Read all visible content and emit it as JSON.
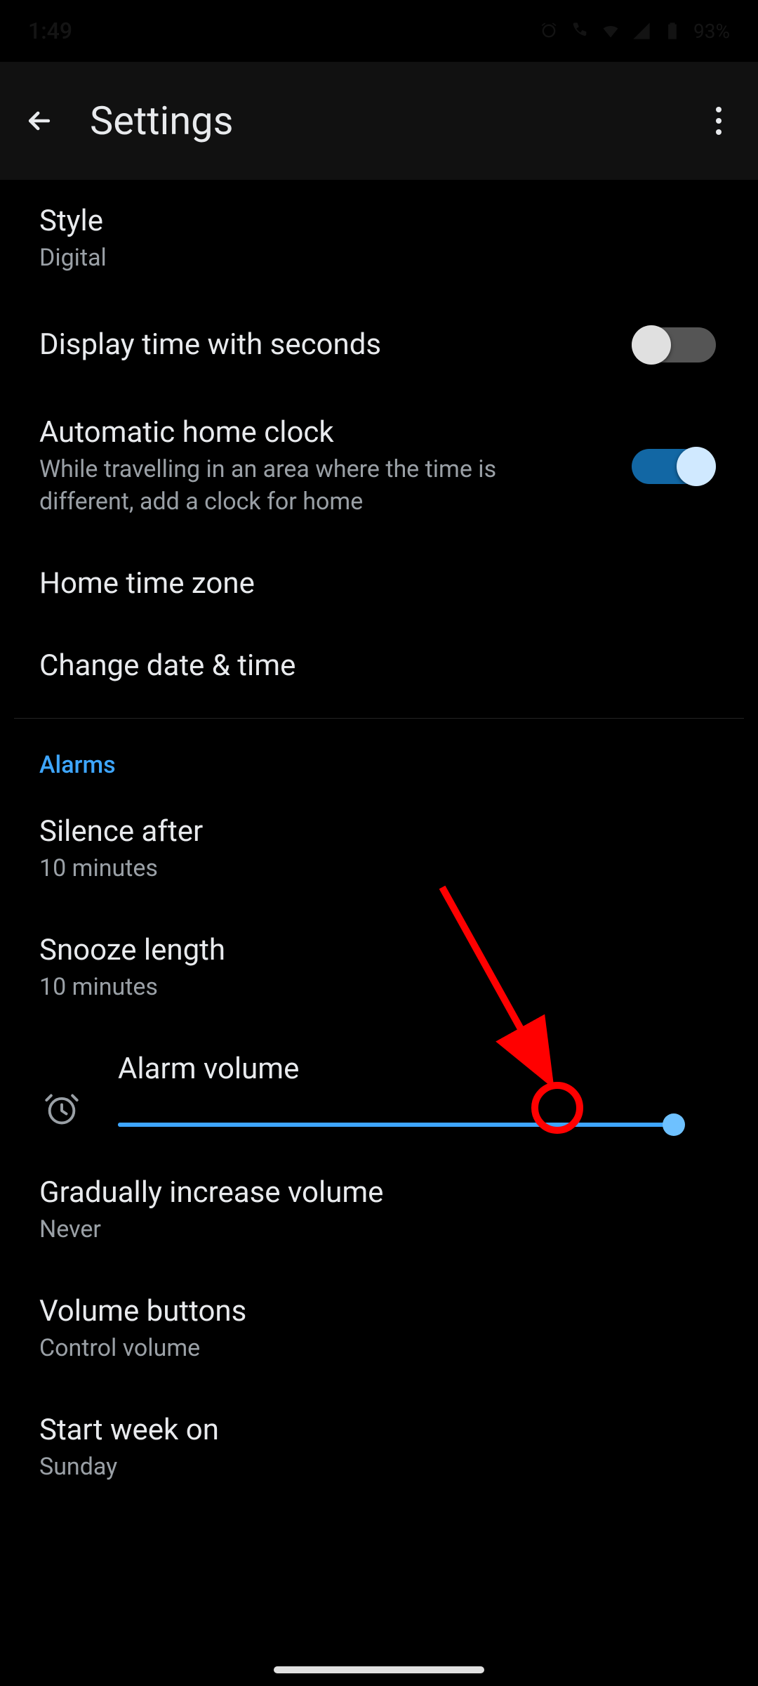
{
  "statusbar": {
    "time": "1:49",
    "battery_text": "93%"
  },
  "toolbar": {
    "title": "Settings"
  },
  "sections": {
    "style": {
      "title": "Style",
      "value": "Digital"
    },
    "displaySeconds": {
      "title": "Display time with seconds",
      "on": false
    },
    "autoHomeClock": {
      "title": "Automatic home clock",
      "subtitle": "While travelling in an area where the time is different, add a clock for home",
      "on": true
    },
    "homeTimeZone": {
      "title": "Home time zone"
    },
    "changeDateTime": {
      "title": "Change date & time"
    },
    "alarmsHeader": "Alarms",
    "silenceAfter": {
      "title": "Silence after",
      "value": "10 minutes"
    },
    "snoozeLength": {
      "title": "Snooze length",
      "value": "10 minutes"
    },
    "alarmVolume": {
      "title": "Alarm volume",
      "value_percent": 100
    },
    "graduallyIncrease": {
      "title": "Gradually increase volume",
      "value": "Never"
    },
    "volumeButtons": {
      "title": "Volume buttons",
      "value": "Control volume"
    },
    "startWeekOn": {
      "title": "Start week on",
      "value": "Sunday"
    }
  },
  "colors": {
    "accent": "#3ea6ff",
    "annotation": "#ff0000"
  }
}
